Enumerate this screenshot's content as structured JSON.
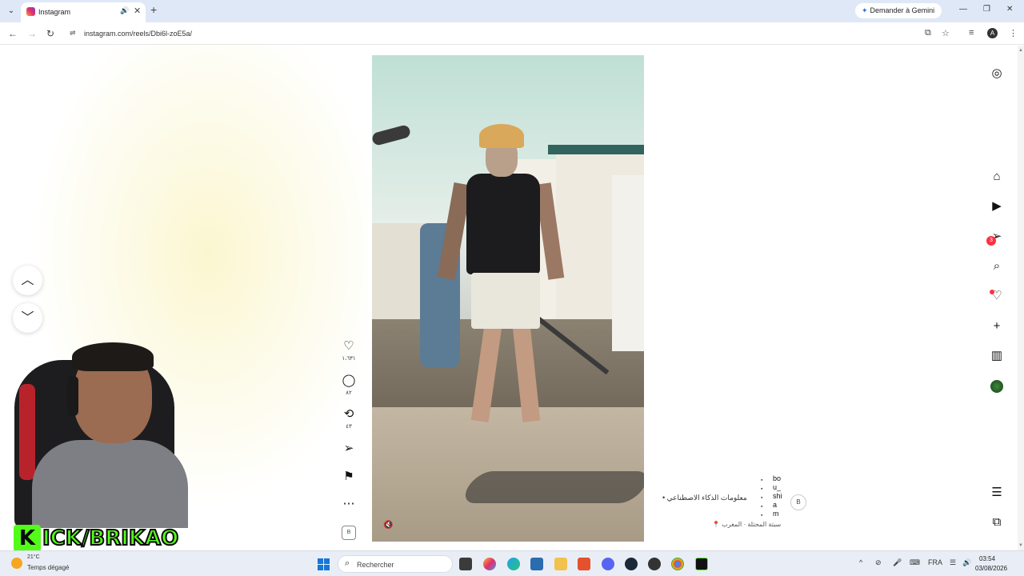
{
  "browser": {
    "tab_title": "Instagram",
    "gemini_label": "Demander à Gemini",
    "url": "instagram.com/reels/Dbi6l-zoE5a/",
    "profile_initial": "A",
    "tab_list_glyph": "⌄",
    "new_tab_glyph": "+",
    "close_glyph": "✕",
    "audio_glyph": "🔊",
    "back_glyph": "←",
    "forward_glyph": "→",
    "reload_glyph": "↻",
    "site_info_glyph": "⇌",
    "minimize_glyph": "—",
    "maximize_glyph": "❐",
    "window_close_glyph": "✕",
    "cast_glyph": "⧉",
    "bookmark_glyph": "☆",
    "reading_glyph": "≡",
    "menu_glyph": "⋮"
  },
  "reel": {
    "nav_up": "︿",
    "nav_down": "﹀",
    "mute_glyph": "🔇",
    "actions": [
      {
        "name": "like",
        "icon": "♡",
        "count": "١،٦٣١"
      },
      {
        "name": "comment",
        "icon": "◯",
        "count": "٨٢"
      },
      {
        "name": "repost",
        "icon": "⟲",
        "count": "٤٣"
      },
      {
        "name": "share",
        "icon": "➢",
        "count": ""
      },
      {
        "name": "save",
        "icon": "⚑",
        "count": ""
      },
      {
        "name": "more",
        "icon": "⋯",
        "count": ""
      }
    ],
    "audio_thumb": "B",
    "caption": {
      "username_lines": [
        "bo",
        "u_",
        "shi",
        "a",
        "m"
      ],
      "text": "• معلومات الذكاء الاصطناعي",
      "location": "📍 سبتة المحتلة · المغرب",
      "avatar_glyph": "B"
    }
  },
  "right_nav": [
    {
      "name": "instagram-logo",
      "icon": "◎"
    },
    {
      "name": "home",
      "icon": "⌂"
    },
    {
      "name": "reels",
      "icon": "▶"
    },
    {
      "name": "messages",
      "icon": "➢"
    },
    {
      "name": "search",
      "icon": "⌕"
    },
    {
      "name": "notifications",
      "icon": "♡"
    },
    {
      "name": "create",
      "icon": "+"
    },
    {
      "name": "dashboard",
      "icon": "▥"
    },
    {
      "name": "more-menu",
      "icon": "☰"
    },
    {
      "name": "also-from-meta",
      "icon": "⧉"
    }
  ],
  "messages_badge": "3",
  "webcam": {
    "kick_logo_letter": "K",
    "kick_text": "ICK/BRIKAO"
  },
  "taskbar": {
    "weather_temp": "21°C",
    "weather_desc": "Temps dégagé",
    "search_placeholder": "Rechercher",
    "language": "FRA",
    "time": "03:54",
    "date": "03/08/2026"
  },
  "colors": {
    "kick_green": "#53fc18",
    "instagram_red": "#ff3040",
    "windows_blue": "#1677d8"
  }
}
